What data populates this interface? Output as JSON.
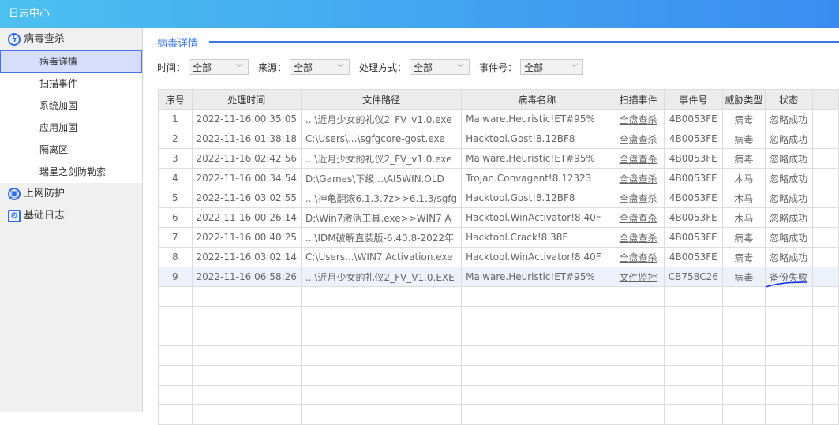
{
  "title": "日志中心",
  "sidebar": {
    "groups": [
      {
        "label": "病毒查杀",
        "items": [
          "病毒详情",
          "扫描事件",
          "系统加固",
          "应用加固",
          "隔离区",
          "瑞星之剑防勒索"
        ]
      },
      {
        "label": "上网防护"
      },
      {
        "label": "基础日志"
      }
    ]
  },
  "section_title": "病毒详情",
  "filters": [
    {
      "label": "时间：",
      "value": "全部"
    },
    {
      "label": "来源：",
      "value": "全部"
    },
    {
      "label": "处理方式：",
      "value": "全部"
    },
    {
      "label": "事件号：",
      "value": "全部"
    }
  ],
  "table": {
    "headers": [
      "序号",
      "处理时间",
      "文件路径",
      "病毒名称",
      "扫描事件",
      "事件号",
      "威胁类型",
      "状态"
    ],
    "rows": [
      [
        "1",
        "2022-11-16 00:35:05",
        "...\\近月少女的礼仪2_FV_v1.0.exe",
        "Malware.Heuristic!ET#95%",
        "全盘查杀",
        "4B0053FE",
        "病毒",
        "忽略成功"
      ],
      [
        "2",
        "2022-11-16 01:38:18",
        "C:\\Users\\...\\sgfgcore-gost.exe",
        "Hacktool.Gost!8.12BF8",
        "全盘查杀",
        "4B0053FE",
        "病毒",
        "忽略成功"
      ],
      [
        "3",
        "2022-11-16 02:42:56",
        "...\\近月少女的礼仪2_FV_v1.0.exe",
        "Malware.Heuristic!ET#95%",
        "全盘查杀",
        "4B0053FE",
        "病毒",
        "忽略成功"
      ],
      [
        "4",
        "2022-11-16 00:34:54",
        "D:\\Games\\下级...\\AI5WIN.OLD",
        "Trojan.Convagent!8.12323",
        "全盘查杀",
        "4B0053FE",
        "木马",
        "忽略成功"
      ],
      [
        "5",
        "2022-11-16 03:02:55",
        "...\\神龟翻滚6.1.3.7z>>6.1.3/sgfg",
        "Hacktool.Gost!8.12BF8",
        "全盘查杀",
        "4B0053FE",
        "木马",
        "忽略成功"
      ],
      [
        "6",
        "2022-11-16 00:26:14",
        "D:\\Win7激活工具.exe>>WIN7 A",
        "Hacktool.WinActivator!8.40F",
        "全盘查杀",
        "4B0053FE",
        "木马",
        "忽略成功"
      ],
      [
        "7",
        "2022-11-16 00:40:25",
        "...\\IDM破解直装版-6.40.8-2022年",
        "Hacktool.Crack!8.38F",
        "全盘查杀",
        "4B0053FE",
        "病毒",
        "忽略成功"
      ],
      [
        "8",
        "2022-11-16 03:02:14",
        "C:\\Users...\\WIN7 Activation.exe",
        "Hacktool.WinActivator!8.40F",
        "全盘查杀",
        "4B0053FE",
        "病毒",
        "忽略成功"
      ],
      [
        "9",
        "2022-11-16 06:58:26",
        "...\\近月少女的礼仪2_FV_V1.0.EXE",
        "Malware.Heuristic!ET#95%",
        "文件监控",
        "CB758C26",
        "病毒",
        "备份失败"
      ]
    ]
  }
}
